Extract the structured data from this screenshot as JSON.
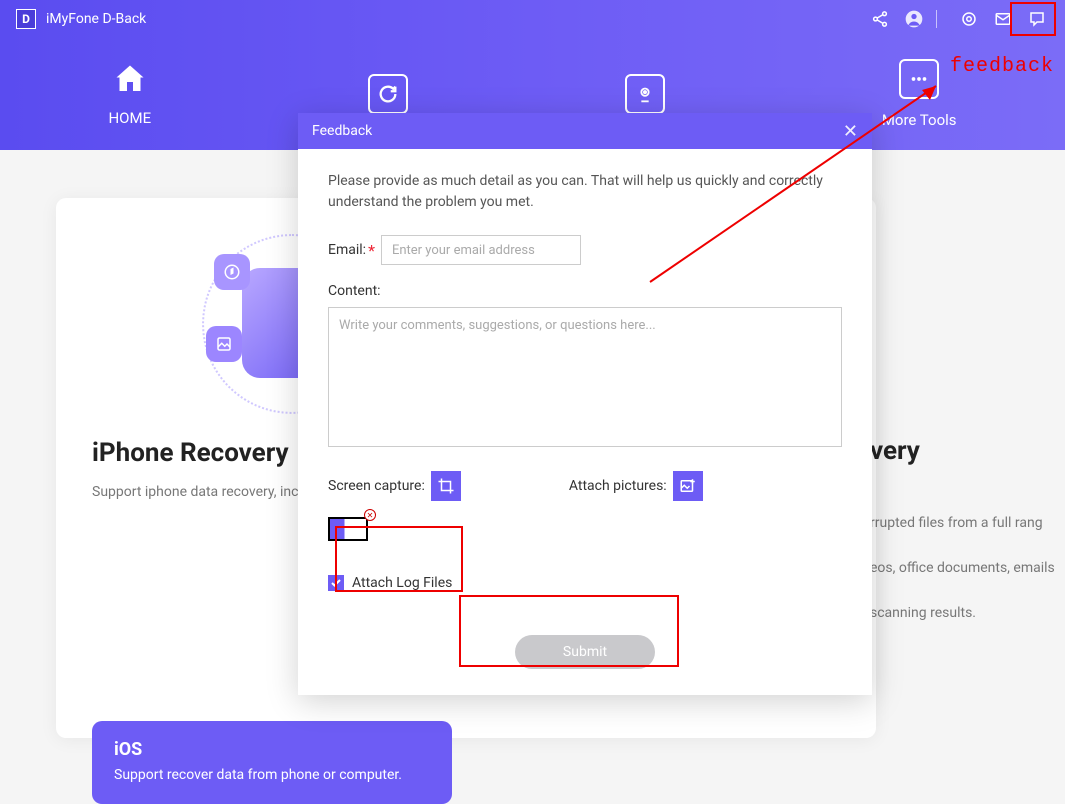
{
  "app": {
    "title": "iMyFone D-Back",
    "logo_letter": "D"
  },
  "nav": {
    "home": "HOME",
    "more_tools": "More Tools"
  },
  "main": {
    "iphone_recovery_title": "iPhone Recovery",
    "iphone_recovery_desc": "Support iphone data recovery, including photos, videos, and other media files, calls, contacts…",
    "ios_card_title": "iOS",
    "ios_card_desc": "Support recover data from phone or computer.",
    "right_heading_suffix": "very",
    "right_line_1": "rrupted files from a full rang",
    "right_line_2": "eos, office documents, emails",
    "right_line_3": "scanning results."
  },
  "feedback": {
    "title": "Feedback",
    "intro": "Please provide as much detail as you can. That will help us quickly and correctly understand the problem you met.",
    "email_label": "Email:",
    "email_placeholder": "Enter your email address",
    "content_label": "Content:",
    "content_placeholder": "Write your comments, suggestions, or questions here...",
    "screen_capture_label": "Screen capture:",
    "attach_pictures_label": "Attach pictures:",
    "attach_log_label": "Attach Log Files",
    "submit_label": "Submit"
  },
  "annotation": {
    "feedback_text": "feedback"
  }
}
